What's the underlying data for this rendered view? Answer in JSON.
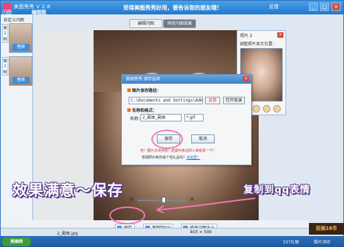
{
  "window": {
    "app_title": "美图秀秀 V 2.6",
    "menu_label": "闪图",
    "tab_title": "编辑图",
    "slogan": "觉得美图秀秀好用，要告诉您的朋友哦！",
    "feedback": "反馈",
    "buttons": [
      "_",
      "□",
      "×"
    ]
  },
  "left_panel": {
    "label": "自定义闪图",
    "frames": [
      {
        "index": "第1帧",
        "replace": "替换"
      },
      {
        "index": "第2帧",
        "replace": "替换"
      }
    ]
  },
  "tabs": [
    {
      "label": "编辑闪图",
      "active": false
    },
    {
      "label": "预览闪图效果",
      "active": true
    }
  ],
  "save_dialog": {
    "title": "美图秀秀 保存选项",
    "path_section": "图片保存路径：",
    "path_value": "C:\\Documents and Settings\\Admir",
    "browse_label": "另存",
    "open_dir_label": "打开目录",
    "name_section": "名称和格式：",
    "name_label": "名称：",
    "name_value": "2_副本_副本",
    "format_value": "*.gif",
    "save_label": "保存",
    "cancel_label": "取消",
    "warning": "哇！图片太漂亮啦！赶紧叫身边的人来看看一下！",
    "gift_text": "想把照片制作成个性礼品吗？",
    "gift_link": "点这里！"
  },
  "side_panel": {
    "title": "照片 2",
    "subtitle": "调整照片显示位置："
  },
  "zoom": {
    "slow_label": "慢",
    "fast_label": "快",
    "level": 0.55
  },
  "bottom_bar": {
    "save_label": "保存",
    "copy_qq_label": "复制到QQ",
    "modify_label": "修改闪图大小"
  },
  "status_bar": {
    "filename": "2_副本.jpg",
    "dimensions": "403 × 500"
  },
  "taskbar": {
    "start_label": "美图网",
    "tray_items": [
      "337礼物",
      "照片冲印"
    ]
  },
  "ad_banner": "狂雨18币",
  "overlays": {
    "main_caption": "效果满意～保存",
    "qq_caption": "复制到qq表情"
  },
  "colors": {
    "title_blue": "#2278cc",
    "caption_purple": "#5b3d8a",
    "highlight_pink": "#f07ab8",
    "warning_red": "#d02a2a"
  }
}
